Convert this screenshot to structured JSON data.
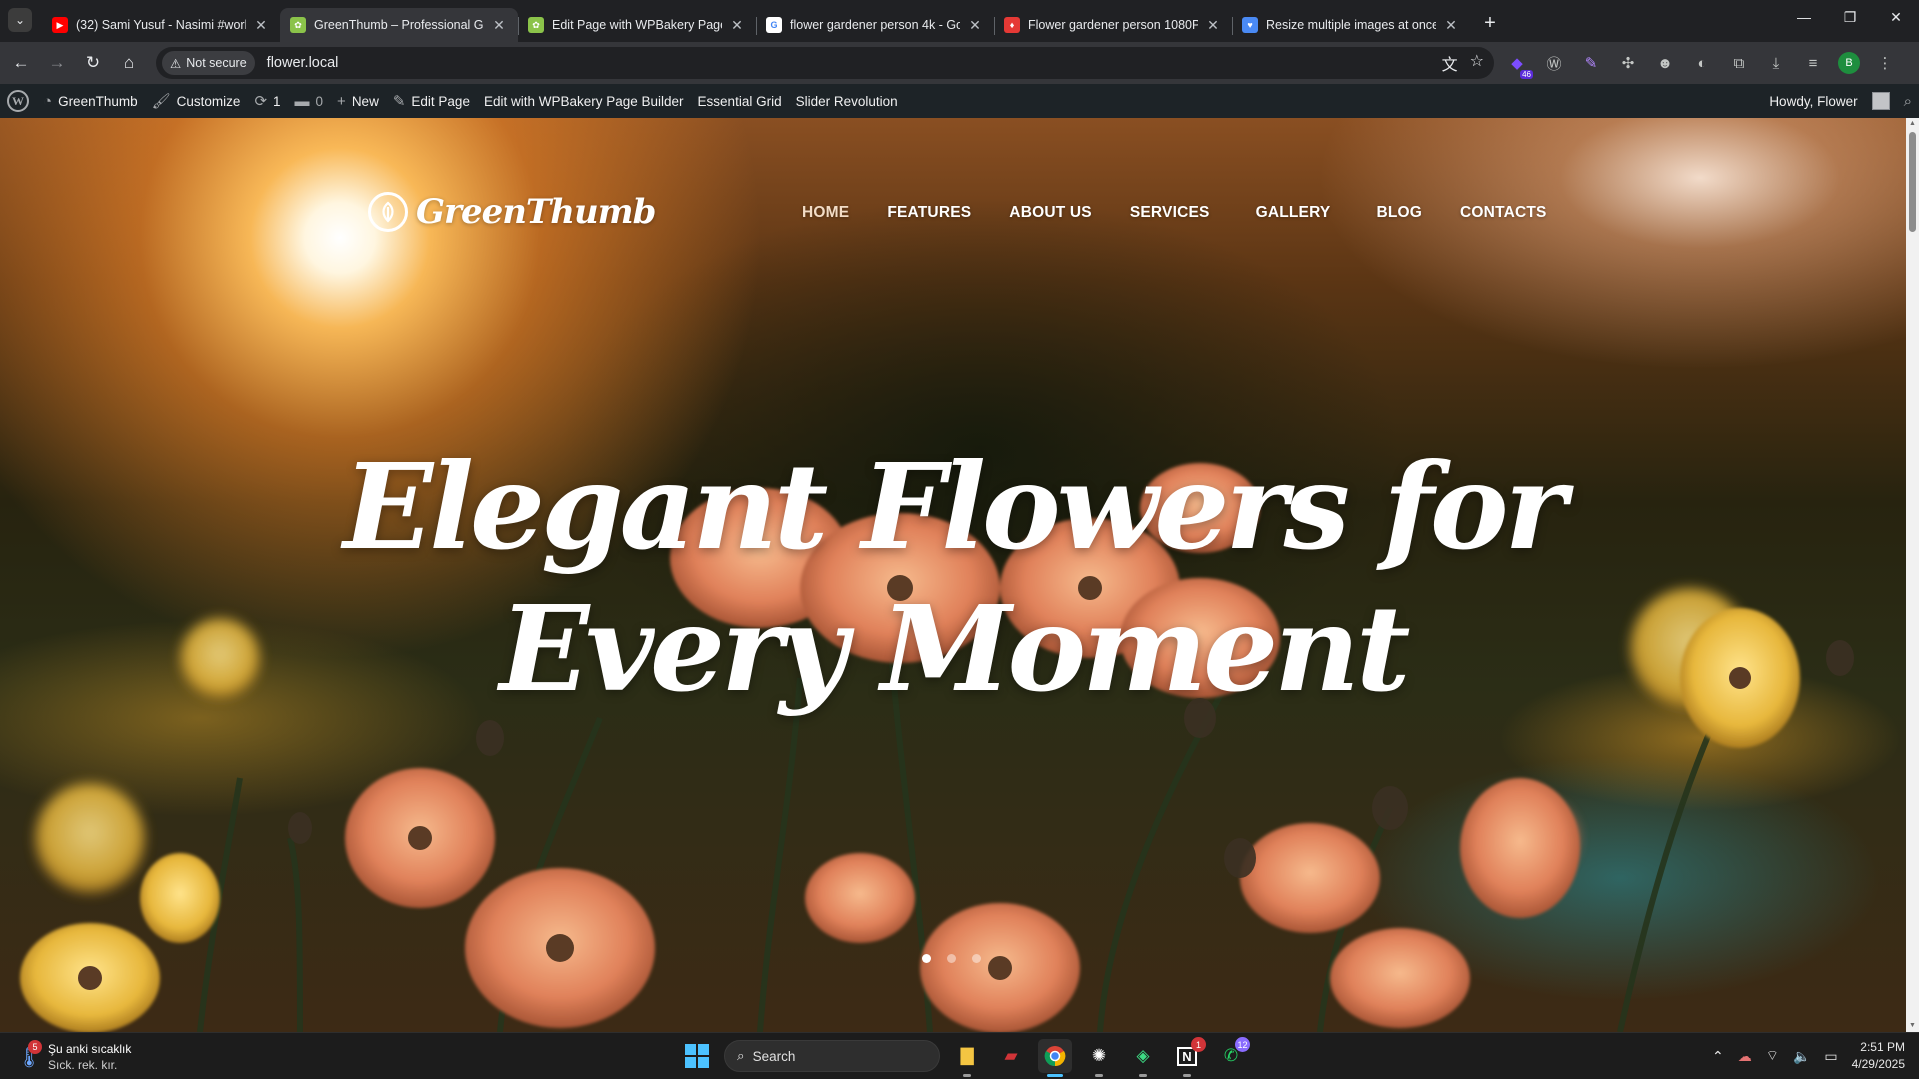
{
  "browser": {
    "tabs": [
      {
        "title": "(32) Sami Yusuf - Nasimi #work",
        "favicon": "youtube-icon",
        "color": "#ff0000",
        "active": false
      },
      {
        "title": "GreenThumb – Professional Gar",
        "favicon": "greenthumb-icon",
        "color": "#8bc34a",
        "active": true
      },
      {
        "title": "Edit Page with WPBakery Page B",
        "favicon": "greenthumb-icon",
        "color": "#8bc34a",
        "active": false
      },
      {
        "title": "flower gardener person 4k - Go",
        "favicon": "google-icon",
        "color": "#4285f4",
        "active": false
      },
      {
        "title": "Flower gardener person 1080P,",
        "favicon": "fire-icon",
        "color": "#e53935",
        "active": false
      },
      {
        "title": "Resize multiple images at once!",
        "favicon": "heart-icon",
        "color": "#4a8af4",
        "active": false
      }
    ],
    "security_label": "Not secure",
    "url": "flower.local",
    "extension_badge": "46",
    "profile_initial": "B"
  },
  "admin_bar": {
    "site_name": "GreenThumb",
    "customize": "Customize",
    "updates_count": "1",
    "comments_count": "0",
    "new_label": "New",
    "edit_page": "Edit Page",
    "wpbakery": "Edit with WPBakery Page Builder",
    "essential_grid": "Essential Grid",
    "slider_revolution": "Slider Revolution",
    "howdy": "Howdy, Flower"
  },
  "site": {
    "logo_text": "GreenThumb",
    "nav": [
      "HOME",
      "FEATURES",
      "ABOUT US",
      "SERVICES",
      "GALLERY",
      "BLOG",
      "CONTACTS"
    ],
    "current_nav": "HOME",
    "hero_line1": "Elegant Flowers for",
    "hero_line2": "Every Moment",
    "slide_count": 3,
    "active_slide": 1
  },
  "taskbar": {
    "weather_title": "Şu anki sıcaklık",
    "weather_sub": "Sıck. rek. kır.",
    "weather_badge": "5",
    "search_label": "Search",
    "notion_badge": "1",
    "whatsapp_badge": "12",
    "time": "2:51 PM",
    "date": "4/29/2025"
  }
}
